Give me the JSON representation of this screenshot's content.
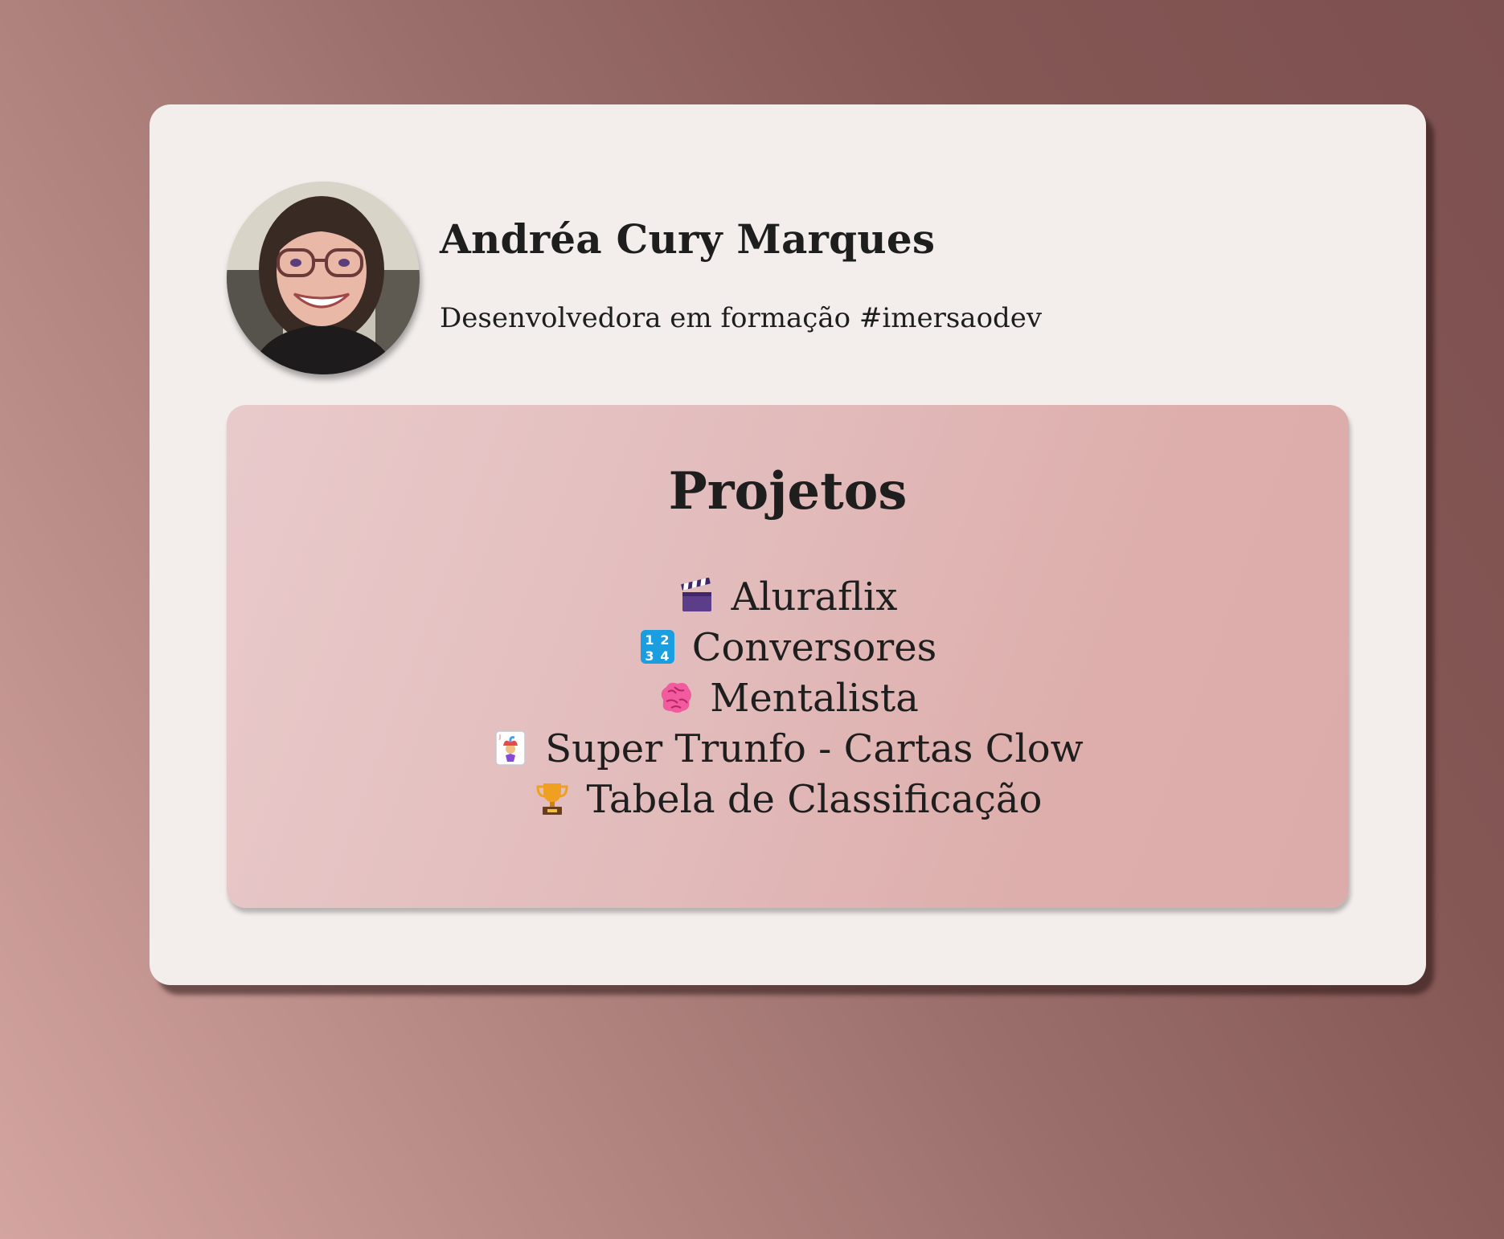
{
  "profile": {
    "name": "Andréa Cury Marques",
    "bio": "Desenvolvedora em formação #imersaodev"
  },
  "projects": {
    "title": "Projetos",
    "items": [
      {
        "icon": "clapper-board-icon",
        "label": "Aluraflix"
      },
      {
        "icon": "input-numbers-icon",
        "label": "Conversores"
      },
      {
        "icon": "brain-icon",
        "label": "Mentalista"
      },
      {
        "icon": "joker-card-icon",
        "label": "Super Trunfo - Cartas Clow"
      },
      {
        "icon": "trophy-icon",
        "label": "Tabela de Classificação"
      }
    ]
  },
  "colors": {
    "background_light": "#d3a4a0",
    "background_dark": "#7d5150",
    "card": "#f3eeec",
    "projects_panel": "#e2bbbb",
    "text": "#1e1e1e"
  }
}
